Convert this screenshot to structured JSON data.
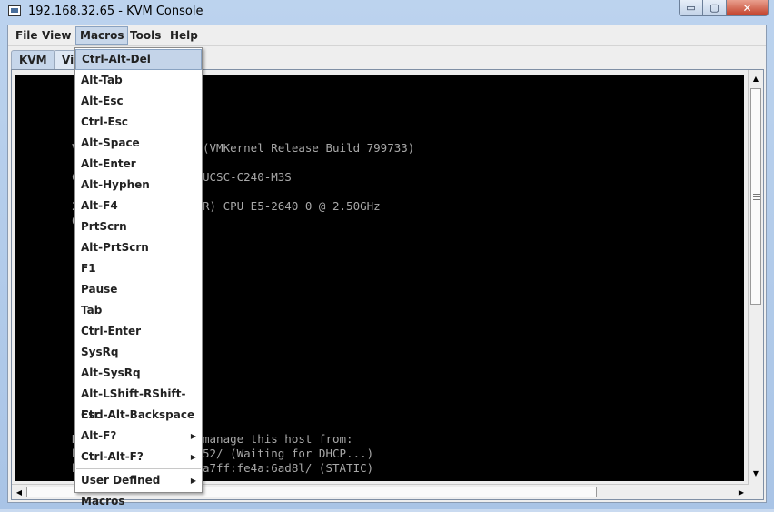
{
  "window": {
    "title": "192.168.32.65 - KVM Console",
    "min": "▭",
    "max": "▢",
    "close": "✕"
  },
  "menubar": [
    "File",
    "View",
    "Macros",
    "Tools",
    "Help"
  ],
  "tabs": [
    "KVM",
    "Vi"
  ],
  "terminal": [
    "V",
    "(VMKernel Release Build 799733)",
    "C",
    "UCSC-C240-M3S",
    "2",
    "R) CPU E5-2640 0 @ 2.50GHz",
    "6",
    "D",
    "manage this host from:",
    "h",
    "52/ (Waiting for DHCP...)",
    "h",
    "a7ff:fe4a:6ad8l/ (STATIC)"
  ],
  "macros_menu": {
    "items": [
      "Ctrl-Alt-Del",
      "Alt-Tab",
      "Alt-Esc",
      "Ctrl-Esc",
      "Alt-Space",
      "Alt-Enter",
      "Alt-Hyphen",
      "Alt-F4",
      "PrtScrn",
      "Alt-PrtScrn",
      "F1",
      "Pause",
      "Tab",
      "Ctrl-Enter",
      "SysRq",
      "Alt-SysRq",
      "Alt-LShift-RShift-Esc",
      "Ctrl-Alt-Backspace",
      "Alt-F?",
      "Ctrl-Alt-F?"
    ],
    "user_defined": "User Defined Macros",
    "submenu_arrow": "▶"
  },
  "scroll": {
    "up": "▲",
    "down": "▼",
    "left": "◀",
    "right": "▶"
  },
  "colors": {
    "highlight": "#c4d4e9",
    "terminal_bg": "#000000",
    "terminal_fg": "#a8a8a8"
  }
}
